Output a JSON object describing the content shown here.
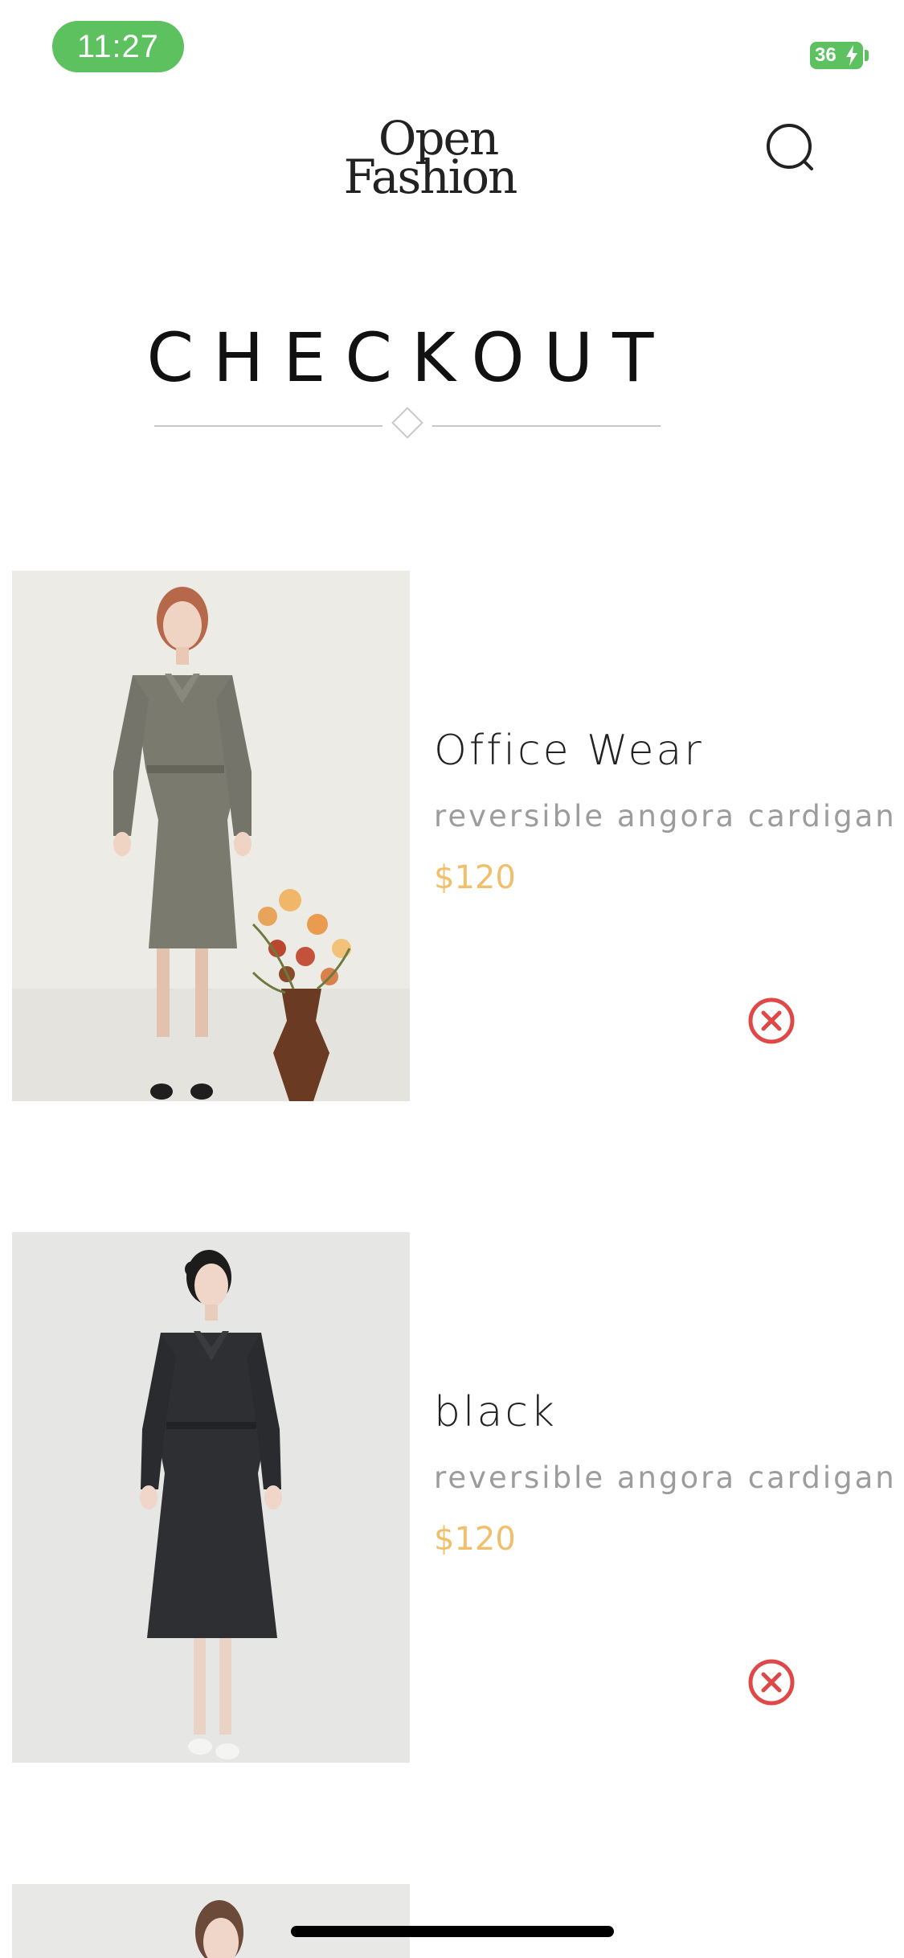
{
  "status_bar": {
    "time": "11:27",
    "battery_level": "36",
    "battery_color": "#5cc15e"
  },
  "header": {
    "logo_line1": "Open",
    "logo_line2": "Fashion",
    "search_icon": "search-icon"
  },
  "page": {
    "title": "CHECKOUT"
  },
  "cart": {
    "items": [
      {
        "name": "Office Wear",
        "description": "reversible angora cardigan",
        "price": "$120",
        "remove_icon": "remove-circle-icon"
      },
      {
        "name": "black",
        "description": "reversible angora cardigan",
        "price": "$120",
        "remove_icon": "remove-circle-icon"
      }
    ]
  },
  "colors": {
    "price": "#f1be6a",
    "remove": "#e04848",
    "text": "#222222",
    "muted": "#9c9c9c"
  }
}
